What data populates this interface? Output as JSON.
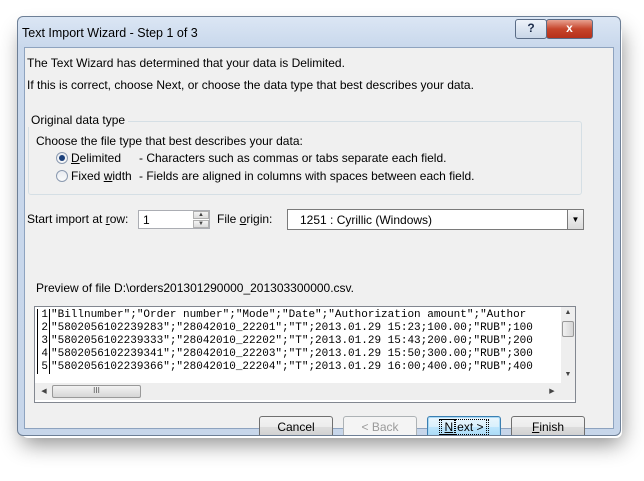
{
  "window": {
    "title": "Text Import Wizard - Step 1 of 3",
    "help_label": "?",
    "close_label": "x"
  },
  "intro": {
    "line1": "The Text Wizard has determined that your data is Delimited.",
    "line2": "If this is correct, choose Next, or choose the data type that best describes your data."
  },
  "original_data_type": {
    "group_label": "Original data type",
    "prompt": "Choose the file type that best describes your data:",
    "options": [
      {
        "label": "Delimited",
        "mnemonic_before": "",
        "mnemonic": "D",
        "mnemonic_after": "elimited",
        "description": "- Characters such as commas or tabs separate each field.",
        "selected": true
      },
      {
        "label": "Fixed width",
        "mnemonic_before": "Fixed ",
        "mnemonic": "w",
        "mnemonic_after": "idth",
        "description": "- Fields are aligned in columns with spaces between each field.",
        "selected": false
      }
    ]
  },
  "start_row": {
    "label_before": "Start import at ",
    "label_mnemonic": "r",
    "label_after": "ow:",
    "value": "1"
  },
  "file_origin": {
    "label_before": "File ",
    "label_mnemonic": "o",
    "label_after": "rigin:",
    "value": "1251 : Cyrillic (Windows)"
  },
  "preview": {
    "label": "Preview of file D:\\orders201301290000_201303300000.csv.",
    "lines": [
      {
        "num": "1",
        "text": "\"Billnumber\";\"Order number\";\"Mode\";\"Date\";\"Authorization amount\";\"Author"
      },
      {
        "num": "2",
        "text": "\"5802056102239283\";\"28042010_22201\";\"T\";2013.01.29 15:23;100.00;\"RUB\";100"
      },
      {
        "num": "3",
        "text": "\"5802056102239333\";\"28042010_22202\";\"T\";2013.01.29 15:43;200.00;\"RUB\";200"
      },
      {
        "num": "4",
        "text": "\"5802056102239341\";\"28042010_22203\";\"T\";2013.01.29 15:50;300.00;\"RUB\";300"
      },
      {
        "num": "5",
        "text": "\"5802056102239366\";\"28042010_22204\";\"T\";2013.01.29 16:00;400.00;\"RUB\";400"
      }
    ],
    "hscroll_thumb_grip": "III"
  },
  "buttons": {
    "cancel": "Cancel",
    "back": "< Back",
    "next_mnemonic": "N",
    "next_rest": "ext >",
    "finish_mnemonic": "F",
    "finish_rest": "inish"
  },
  "colors": {
    "title_bar": "#c9d8ec",
    "client_bg": "#f0f0f0",
    "close_button": "#c6452b",
    "default_button_border": "#3c7fb1"
  }
}
